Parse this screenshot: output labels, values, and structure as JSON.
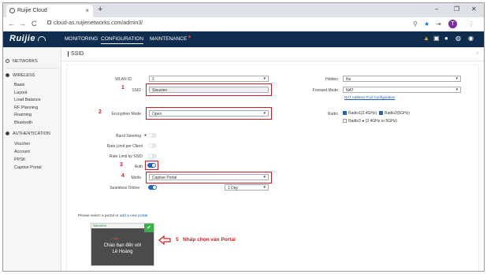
{
  "browser": {
    "tab_title": "Ruijie Cloud",
    "tab_close": "×",
    "new_tab": "+",
    "url": "cloud-as.ruijienetworks.com/admin3/",
    "back": "←",
    "forward": "→",
    "reload": "C",
    "zoom_icon": "⚲",
    "star_icon": "★",
    "ext_icon": "⇥",
    "profile_initial": "T",
    "menu_icon": "⋮",
    "minimize": "–",
    "restore": "❐",
    "close": "✕"
  },
  "header": {
    "logo": "Ruijie",
    "menu": [
      "MONITORING",
      "CONFIGURATION",
      "MAINTENANCE"
    ],
    "active_menu": "CONFIGURATION",
    "icons": [
      "warning-icon",
      "grid-icon",
      "bell-icon",
      "globe-icon",
      "user-icon"
    ]
  },
  "sidebar": {
    "networks": "NETWORKS",
    "wireless": "WIRELESS",
    "wireless_items": [
      "Basic",
      "Layout",
      "Load Balance",
      "RF Planning",
      "Roaming",
      "Bluetooth"
    ],
    "authentication": "AUTHENTICATION",
    "auth_items": [
      "Voucher",
      "Account",
      "PPSK",
      "Captive Portal"
    ]
  },
  "main": {
    "title": "SSID",
    "close": "×",
    "form": {
      "wlan_id_label": "WLAN ID",
      "wlan_id_value": "2",
      "ssid_label": "SSID",
      "ssid_value": "Sieuvien",
      "encryption_label": "Encryption Mode",
      "encryption_value": "Open",
      "band_steering_label": "Band Steering",
      "rate_client_label": "Rate Limit per Client",
      "rate_ssid_label": "Rate Limit by SSID",
      "auth_label": "Auth",
      "mode_label": "Mode",
      "mode_value": "Captive Portal",
      "seamless_label": "Seamless Online",
      "seamless_value": "1 Day",
      "hidden_label": "Hidden",
      "hidden_value": "No",
      "forward_label": "Forward Mode",
      "forward_value": "NAT",
      "nat_link": "NAT Address Pool Configuration",
      "radio_label": "Radio",
      "radio1": "Radio1(2.4GHz)",
      "radio2": "Radio2(5GHz)",
      "radio3": "Radio3",
      "radio3_note": "(2.4GHz or 5GHz)"
    },
    "steps": {
      "s1": "1",
      "s2": "2",
      "s3": "3",
      "s4": "4",
      "s5": "5",
      "s5_text": "Nhấp chọn vào Portal"
    },
    "portal": {
      "note_prefix": "Please select a portal or",
      "note_link": "add a new portal",
      "card_name": "Sieuvien",
      "card_brand": "Ruijie",
      "card_line1": "Chào bạn đến với",
      "card_line2": "Lê Hoàng",
      "check": "✔"
    }
  }
}
